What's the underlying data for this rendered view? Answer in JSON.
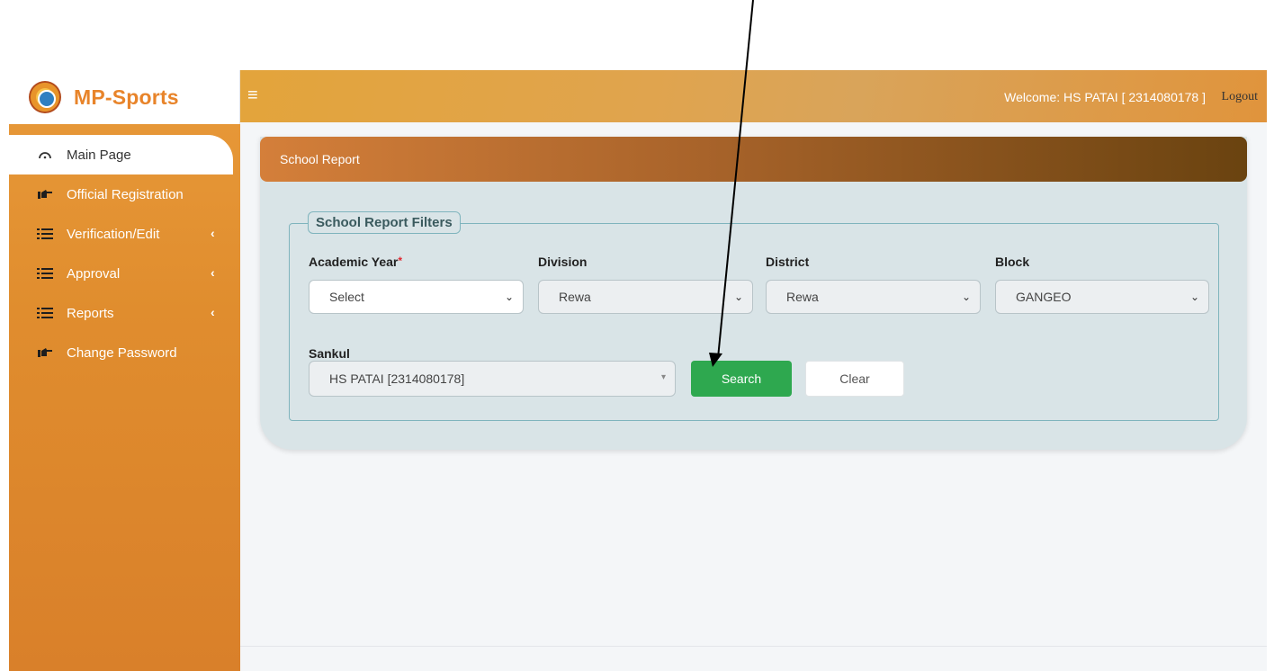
{
  "brand": {
    "name": "MP-Sports"
  },
  "sidebar": {
    "items": [
      {
        "label": "Main Page",
        "icon": "dashboard-gauge-icon",
        "has_submenu": false,
        "active": true
      },
      {
        "label": "Official Registration",
        "icon": "pointing-hand-icon",
        "has_submenu": false,
        "active": false
      },
      {
        "label": "Verification/Edit",
        "icon": "list-icon",
        "has_submenu": true,
        "active": false
      },
      {
        "label": "Approval",
        "icon": "list-icon",
        "has_submenu": true,
        "active": false
      },
      {
        "label": "Reports",
        "icon": "list-icon",
        "has_submenu": true,
        "active": false
      },
      {
        "label": "Change Password",
        "icon": "pointing-hand-icon",
        "has_submenu": false,
        "active": false
      }
    ]
  },
  "topbar": {
    "welcome_text": "Welcome: HS PATAI [ 2314080178 ]",
    "logout_label": "Logout"
  },
  "card": {
    "title": "School Report"
  },
  "filters": {
    "legend": "School Report Filters",
    "academic_year": {
      "label": "Academic Year",
      "required_mark": "*",
      "value": "Select"
    },
    "division": {
      "label": "Division",
      "value": "Rewa"
    },
    "district": {
      "label": "District",
      "value": "Rewa"
    },
    "block": {
      "label": "Block",
      "value": "GANGEO"
    },
    "sankul": {
      "label": "Sankul",
      "value": "HS PATAI [2314080178]"
    },
    "search_label": "Search",
    "clear_label": "Clear"
  },
  "colors": {
    "sidebar": "#e08d2e",
    "brand_text": "#e8842a",
    "search_button": "#2ea84f",
    "card_header_start": "#d47f3a",
    "card_header_end": "#6a4310",
    "fieldset_border": "#7fb4bd"
  }
}
